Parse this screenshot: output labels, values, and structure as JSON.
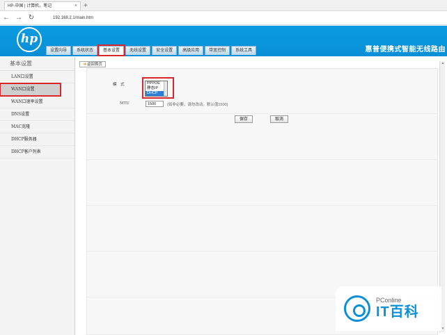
{
  "browser": {
    "tab_title": "HP-中国 | 计算机，笔记",
    "tab_close": "×",
    "new_tab": "+",
    "url": "192.168.2.1/main.htm",
    "back": "←",
    "forward": "→",
    "refresh": "↻"
  },
  "header": {
    "logo_text": "hp",
    "title": "惠普便携式智能无线路由"
  },
  "menu": {
    "items": [
      {
        "label": "设置向导"
      },
      {
        "label": "系统状态"
      },
      {
        "label": "基本设置"
      },
      {
        "label": "无线设置"
      },
      {
        "label": "安全设置"
      },
      {
        "label": "高级应用"
      },
      {
        "label": "带宽控制"
      },
      {
        "label": "系统工具"
      }
    ]
  },
  "sidebar": {
    "title": "基本设置",
    "items": [
      {
        "label": "LAN口设置"
      },
      {
        "label": "WAN口设置"
      },
      {
        "label": "WAN口速率设置"
      },
      {
        "label": "DNS设置"
      },
      {
        "label": "MAC克隆"
      },
      {
        "label": "DHCP服务器"
      },
      {
        "label": "DHCP客户列表"
      }
    ]
  },
  "main": {
    "back_label": "返回首页",
    "mode_label": "模　式",
    "mode_options": [
      "PPPOE",
      "静态IP",
      "DHCP"
    ],
    "mtu_label": "MTU",
    "mtu_value": "1500",
    "mtu_hint": "(如非必要，请勿改动。默认值1500)",
    "save_label": "保存",
    "cancel_label": "取消"
  },
  "watermark": {
    "small": "PConline",
    "big": "IT百科"
  },
  "colors": {
    "brand_blue": "#0a8fd6",
    "highlight_red": "#d9262c",
    "selected_option": "#2f7fd6"
  }
}
